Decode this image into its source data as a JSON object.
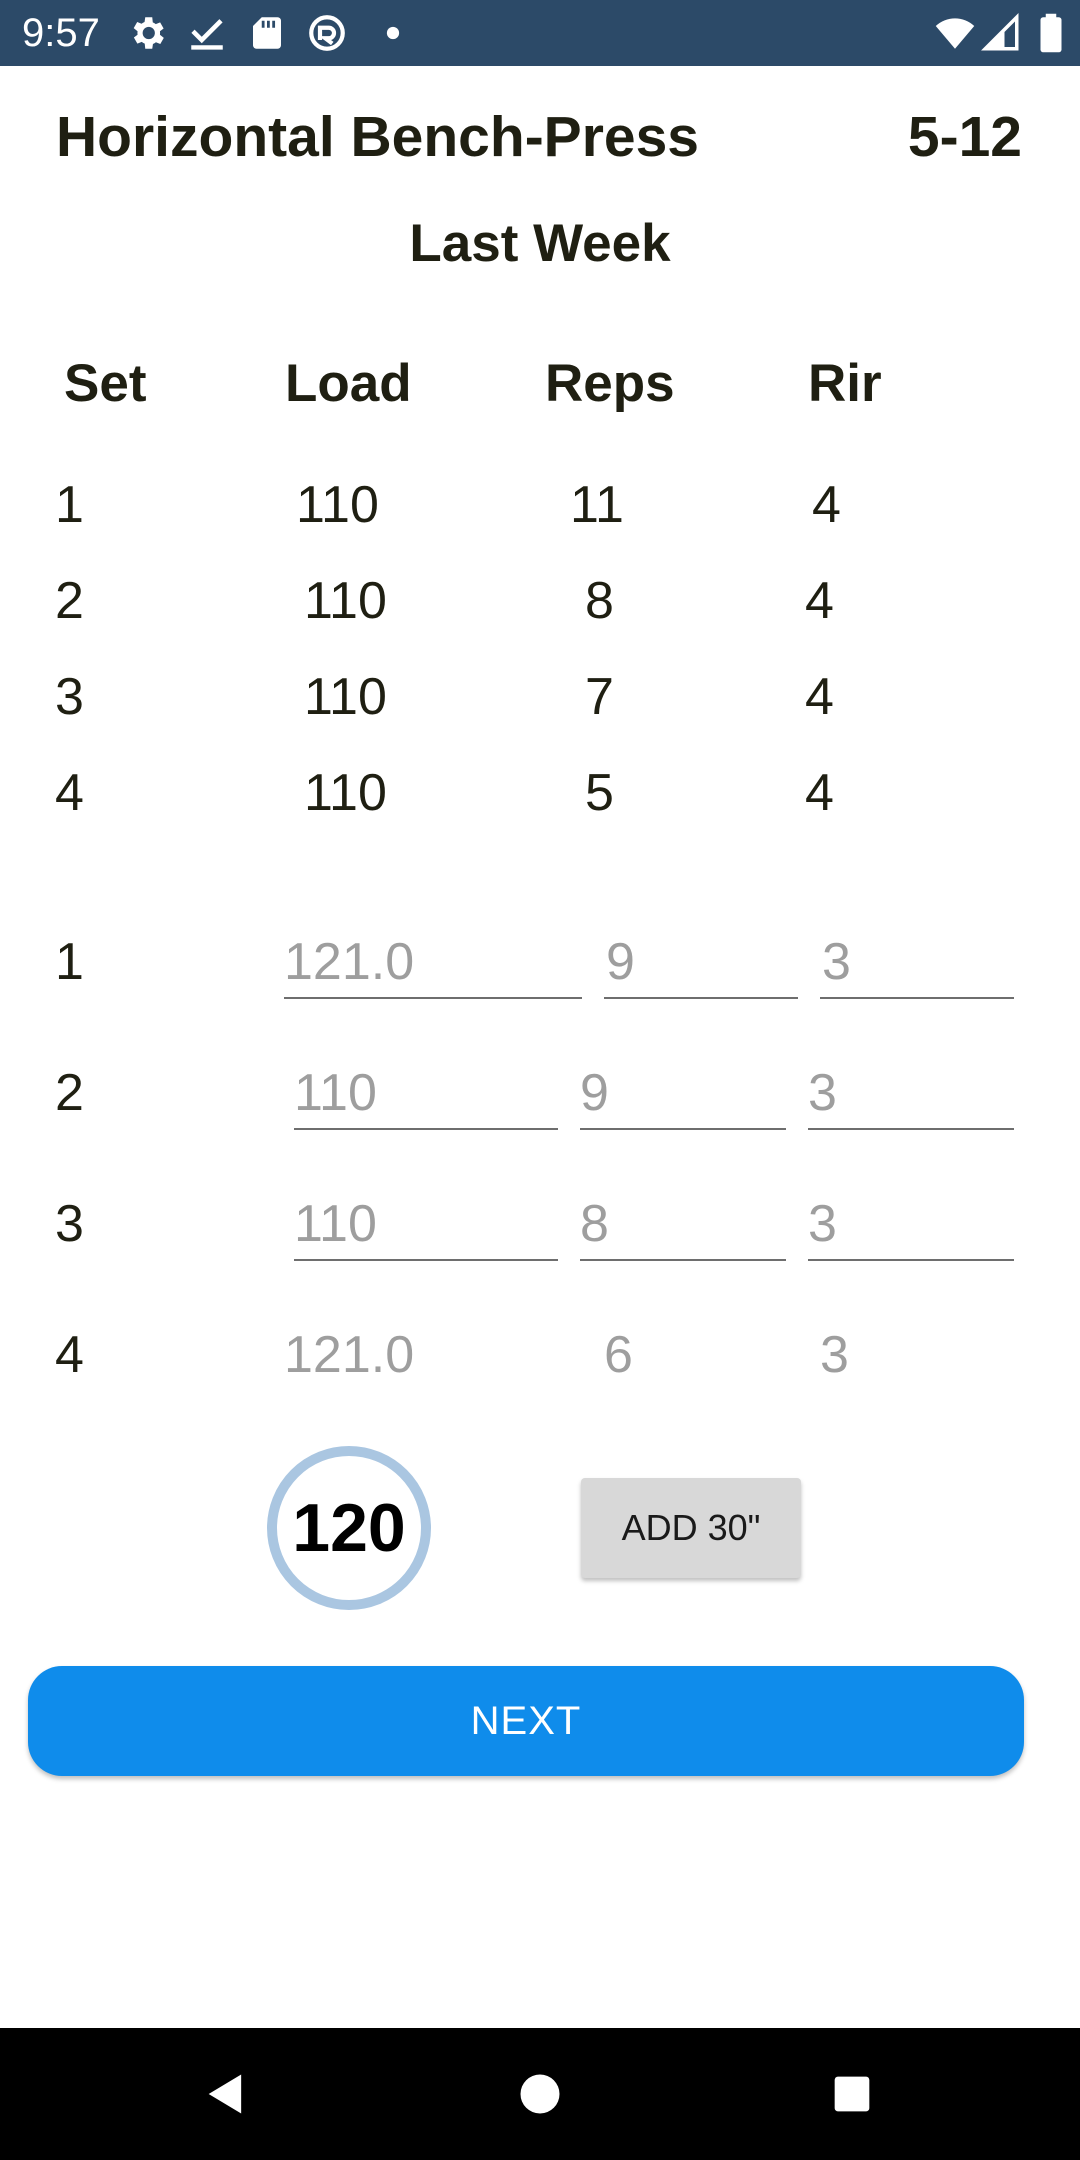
{
  "status_bar": {
    "time": "9:57",
    "left_icons": [
      "gear-icon",
      "checkmark-icon",
      "sd-card-icon",
      "sync-icon",
      "dot-icon"
    ],
    "right_icons": [
      "wifi-icon",
      "cell-signal-icon",
      "battery-icon"
    ]
  },
  "header": {
    "title": "Horizontal Bench-Press",
    "date": "5-12",
    "subtitle": "Last Week"
  },
  "columns": {
    "set": "Set",
    "load": "Load",
    "reps": "Reps",
    "rir": "Rir"
  },
  "last_week": [
    {
      "set": "1",
      "load": "110",
      "reps": "11",
      "rir": "4"
    },
    {
      "set": "2",
      "load": "110",
      "reps": "8",
      "rir": "4"
    },
    {
      "set": "3",
      "load": "110",
      "reps": "7",
      "rir": "4"
    },
    {
      "set": "4",
      "load": "110",
      "reps": "5",
      "rir": "4"
    }
  ],
  "current": [
    {
      "set": "1",
      "load_placeholder": "121.0",
      "reps_placeholder": "9",
      "rir_placeholder": "3"
    },
    {
      "set": "2",
      "load_placeholder": "110",
      "reps_placeholder": "9",
      "rir_placeholder": "3"
    },
    {
      "set": "3",
      "load_placeholder": "110",
      "reps_placeholder": "8",
      "rir_placeholder": "3"
    },
    {
      "set": "4",
      "load_placeholder": "121.0",
      "reps_placeholder": "6",
      "rir_placeholder": "3"
    }
  ],
  "timer": {
    "value": "120",
    "ring_color": "#aac6e1"
  },
  "add_button": "ADD 30\"",
  "next_button": "NEXT",
  "colors": {
    "status_bar": "#2c4a68",
    "accent": "#0f8ceb",
    "text": "#1f1f12",
    "placeholder": "#9e9e9e"
  },
  "nav_bar": {
    "icons": [
      "back-icon",
      "home-icon",
      "recents-icon"
    ]
  }
}
